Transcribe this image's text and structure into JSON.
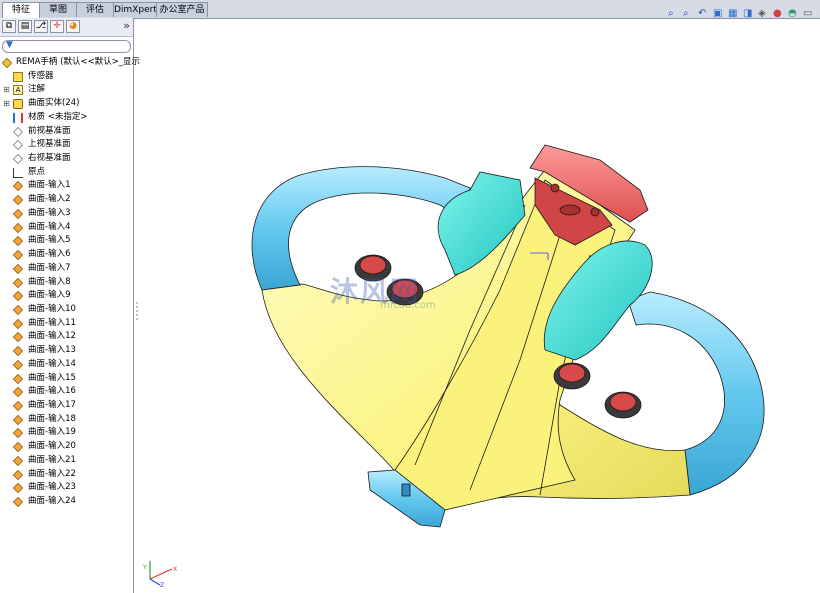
{
  "tabs": [
    "特征",
    "草图",
    "评估",
    "DimXpert",
    "办公室产品"
  ],
  "active_tab": "特征",
  "tree": {
    "root": "REMA手柄 (默认<<默认>_显示",
    "items": [
      {
        "label": "传感器",
        "icon": "sensor-icon",
        "expandable": false
      },
      {
        "label": "注解",
        "icon": "annotation-icon",
        "expandable": true
      },
      {
        "label": "曲面实体(24)",
        "icon": "surface-bodies-icon",
        "expandable": true
      },
      {
        "label": "材质 <未指定>",
        "icon": "material-icon",
        "expandable": false
      },
      {
        "label": "前视基准面",
        "icon": "plane-icon",
        "expandable": false
      },
      {
        "label": "上视基准面",
        "icon": "plane-icon",
        "expandable": false
      },
      {
        "label": "右视基准面",
        "icon": "plane-icon",
        "expandable": false
      },
      {
        "label": "原点",
        "icon": "origin-icon",
        "expandable": false
      },
      {
        "label": "曲面-输入1",
        "icon": "surface-icon",
        "expandable": false
      },
      {
        "label": "曲面-输入2",
        "icon": "surface-icon",
        "expandable": false
      },
      {
        "label": "曲面-输入3",
        "icon": "surface-icon",
        "expandable": false
      },
      {
        "label": "曲面-输入4",
        "icon": "surface-icon",
        "expandable": false
      },
      {
        "label": "曲面-输入5",
        "icon": "surface-icon",
        "expandable": false
      },
      {
        "label": "曲面-输入6",
        "icon": "surface-icon",
        "expandable": false
      },
      {
        "label": "曲面-输入7",
        "icon": "surface-icon",
        "expandable": false
      },
      {
        "label": "曲面-输入8",
        "icon": "surface-icon",
        "expandable": false
      },
      {
        "label": "曲面-输入9",
        "icon": "surface-icon",
        "expandable": false
      },
      {
        "label": "曲面-输入10",
        "icon": "surface-icon",
        "expandable": false
      },
      {
        "label": "曲面-输入11",
        "icon": "surface-icon",
        "expandable": false
      },
      {
        "label": "曲面-输入12",
        "icon": "surface-icon",
        "expandable": false
      },
      {
        "label": "曲面-输入13",
        "icon": "surface-icon",
        "expandable": false
      },
      {
        "label": "曲面-输入14",
        "icon": "surface-icon",
        "expandable": false
      },
      {
        "label": "曲面-输入15",
        "icon": "surface-icon",
        "expandable": false
      },
      {
        "label": "曲面-输入16",
        "icon": "surface-icon",
        "expandable": false
      },
      {
        "label": "曲面-输入17",
        "icon": "surface-icon",
        "expandable": false
      },
      {
        "label": "曲面-输入18",
        "icon": "surface-icon",
        "expandable": false
      },
      {
        "label": "曲面-输入19",
        "icon": "surface-icon",
        "expandable": false
      },
      {
        "label": "曲面-输入20",
        "icon": "surface-icon",
        "expandable": false
      },
      {
        "label": "曲面-输入21",
        "icon": "surface-icon",
        "expandable": false
      },
      {
        "label": "曲面-输入22",
        "icon": "surface-icon",
        "expandable": false
      },
      {
        "label": "曲面-输入23",
        "icon": "surface-icon",
        "expandable": false
      },
      {
        "label": "曲面-输入24",
        "icon": "surface-icon",
        "expandable": false
      }
    ]
  },
  "panel_tools": [
    "feature-manager-icon",
    "property-manager-icon",
    "configuration-manager-icon",
    "dimxpert-manager-icon",
    "display-manager-icon"
  ],
  "view_tools": [
    "zoom-to-fit-icon",
    "zoom-area-icon",
    "previous-view-icon",
    "section-view-icon",
    "view-orientation-icon",
    "display-style-icon",
    "hide-show-icon",
    "edit-appearance-icon",
    "apply-scene-icon",
    "view-settings-icon"
  ],
  "watermark": {
    "main": "沐风网",
    "sub": "mfcad.com"
  },
  "colors": {
    "body": "#fdf88e",
    "handle": "#70d0ee",
    "grip": "#2fd5cf",
    "cap": "#f06c6c",
    "button": "#d84a4a"
  }
}
